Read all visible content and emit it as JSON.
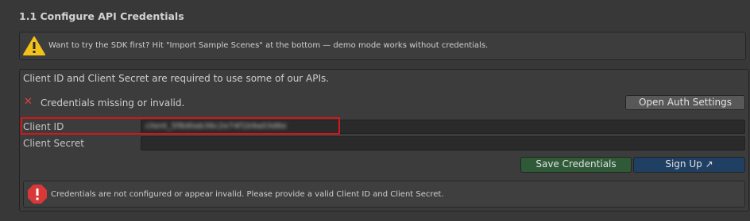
{
  "section": {
    "title": "1.1 Configure API Credentials"
  },
  "warning_box": {
    "icon": "warning-icon",
    "text": "Want to try the SDK first? Hit \"Import Sample Scenes\" at the bottom — demo mode works without credentials."
  },
  "panel": {
    "description": "Client ID and Client Secret are required to use some of our APIs.",
    "status": {
      "icon": "close-icon",
      "icon_glyph": "✕",
      "text": "Credentials missing or invalid."
    },
    "open_auth_button": "Open Auth Settings",
    "fields": {
      "client_id": {
        "label": "Client ID",
        "value": "client_5f8d0ab36c2e74f1b9a03d6e"
      },
      "client_secret": {
        "label": "Client Secret",
        "value": ""
      }
    },
    "save_button": "Save Credentials",
    "signup_button": "Sign Up ↗",
    "error_box": {
      "icon": "error-icon",
      "text": "Credentials are not configured or appear invalid. Please provide a valid Client ID and Client Secret."
    }
  },
  "colors": {
    "background": "#383838",
    "warning_yellow": "#f2c21b",
    "error_red": "#d83838",
    "highlight_red": "#d01818",
    "save_button": "#2f5a38",
    "signup_button": "#1f3f63"
  }
}
